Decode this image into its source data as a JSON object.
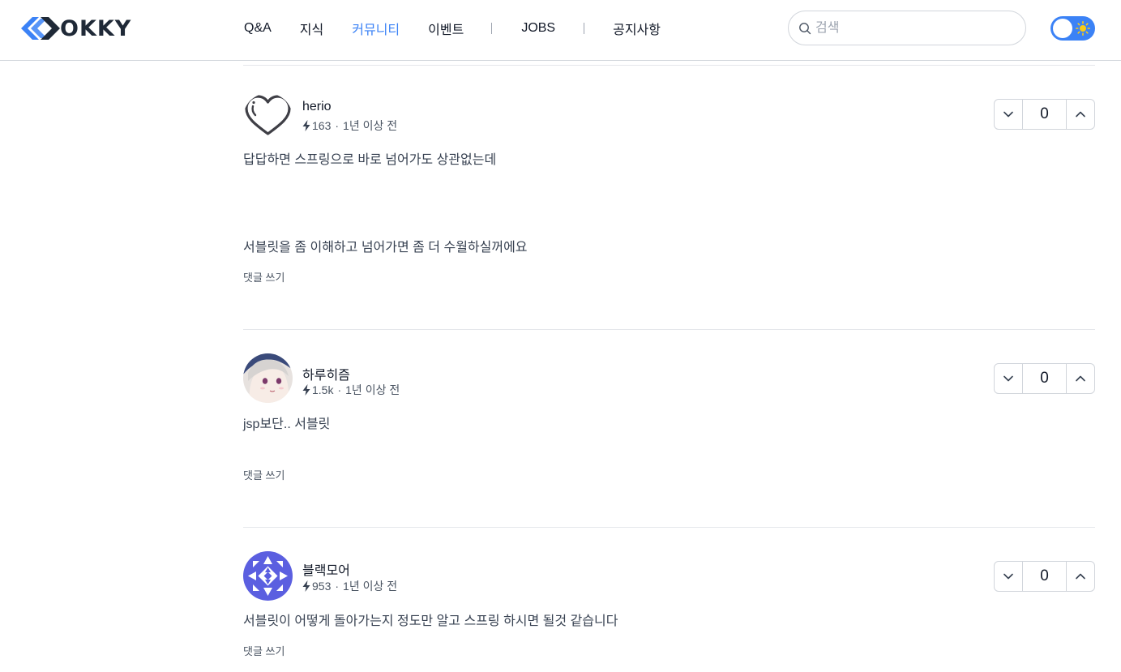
{
  "brand": {
    "name": "OKKY",
    "color": "#3b82f6"
  },
  "nav": {
    "items": [
      {
        "label": "Q&A"
      },
      {
        "label": "지식"
      },
      {
        "label": "커뮤니티",
        "active": true
      },
      {
        "label": "이벤트"
      },
      {
        "label": "JOBS"
      },
      {
        "label": "공지사항"
      }
    ]
  },
  "search": {
    "placeholder": "검색",
    "value": ""
  },
  "theme_toggle": {
    "state": "light",
    "icon": "sun-icon"
  },
  "comments": [
    {
      "author": "herio",
      "avatar": "heart-avatar",
      "points": "163",
      "time": "1년 이상 전",
      "lines": [
        "답답하면 스프링으로 바로 넘어가도 상관없는데",
        "서블릿을 좀 이해하고 넘어가면 좀 더 수월하실꺼에요"
      ],
      "reply_label": "댓글 쓰기",
      "votes": "0"
    },
    {
      "author": "하루히즘",
      "avatar": "anime-character-avatar",
      "points": "1.5k",
      "time": "1년 이상 전",
      "lines": [
        "jsp보단.. 서블릿"
      ],
      "reply_label": "댓글 쓰기",
      "votes": "0"
    },
    {
      "author": "블랙모어",
      "avatar": "geometric-pattern-avatar",
      "points": "953",
      "time": "1년 이상 전",
      "lines": [
        "서블릿이 어떻게 돌아가는지 정도만 알고 스프링 하시면 될것 같습니다"
      ],
      "reply_label": "댓글 쓰기",
      "votes": "0"
    }
  ]
}
